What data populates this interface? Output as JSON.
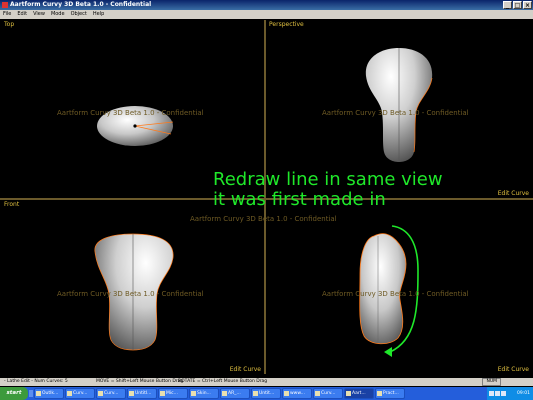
{
  "window": {
    "title": "Aartform Curvy 3D Beta 1.0 - Confidential",
    "buttons": [
      "_",
      "□",
      "×"
    ]
  },
  "menu": [
    "File",
    "Edit",
    "View",
    "Mode",
    "Object",
    "Help"
  ],
  "viewports": {
    "top": {
      "label": "Top",
      "watermark": "Aartform Curvy 3D Beta 1.0 - Confidential"
    },
    "perspective": {
      "label": "Perspective",
      "watermark": "Aartform Curvy 3D Beta 1.0 - Confidential",
      "edit": "Edit Curve"
    },
    "front": {
      "label": "Front",
      "watermark": "Aartform Curvy 3D Beta 1.0 - Confidential",
      "edit": "Edit Curve"
    },
    "side": {
      "watermark": "Aartform Curvy 3D Beta 1.0 - Confidential",
      "edit": "Edit Curve"
    },
    "center_watermark": "Aartform Curvy 3D Beta 1.0 - Confidential"
  },
  "annotation": {
    "line1": "Redraw line in same view",
    "line2": "it was first made in",
    "color": "#1fe82a"
  },
  "status": {
    "mode": "- Lathe Edit - Num Curves: 5",
    "move": "MOVE = Shift+Left Mouse Button Drag",
    "rotate": "ROTATE = Ctrl+Left Mouse Button Drag",
    "num": "NUM"
  },
  "taskbar": {
    "start": "start",
    "tasks": [
      "Outlk...",
      "Curv...",
      "Curv...",
      "Untitl...",
      "Mic...",
      "Skin...",
      "AR_...",
      "Untit...",
      "www...",
      "Curv...",
      "Aart...",
      "Pract..."
    ],
    "active_index": 10,
    "clock": "09:01"
  },
  "colors": {
    "accent": "#e0c040",
    "curve": "#ff7a1a",
    "viewport_border": "#6b5a2b"
  }
}
